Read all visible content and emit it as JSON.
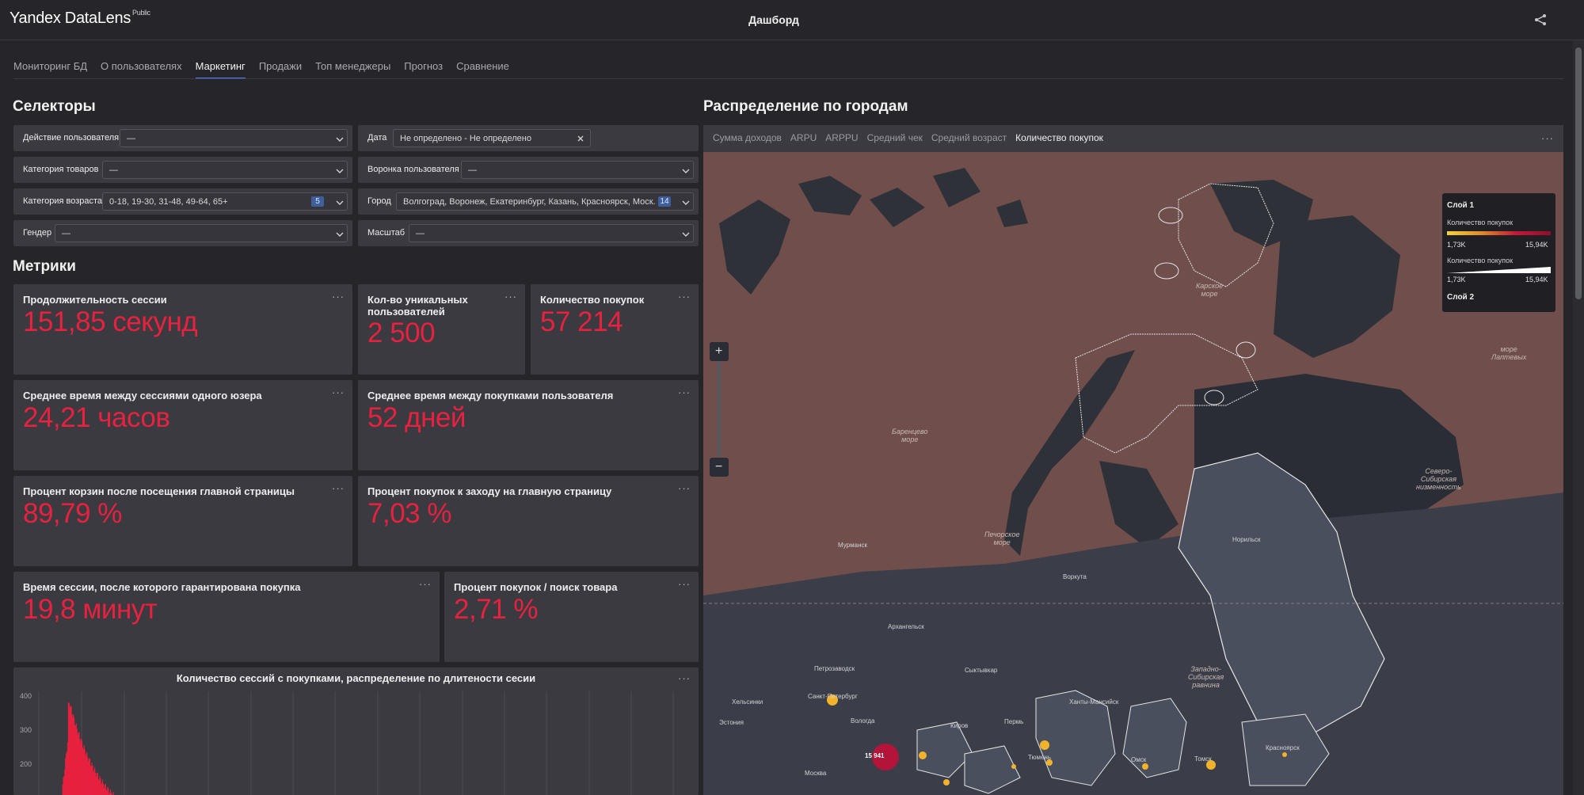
{
  "header": {
    "logo": "Yandex DataLens",
    "logo_badge": "Public",
    "title": "Дашборд"
  },
  "tabs": [
    {
      "label": "Мониторинг БД"
    },
    {
      "label": "О пользователях"
    },
    {
      "label": "Маркетинг",
      "active": true
    },
    {
      "label": "Продажи"
    },
    {
      "label": "Топ менеджеры"
    },
    {
      "label": "Прогноз"
    },
    {
      "label": "Сравнение"
    }
  ],
  "selectors_title": "Селекторы",
  "selectors": {
    "user_action": {
      "label": "Действие пользователя",
      "value": "—"
    },
    "date": {
      "label": "Дата",
      "value": "Не определено - Не определено"
    },
    "product_category": {
      "label": "Категория товаров",
      "value": "—"
    },
    "funnel": {
      "label": "Воронка пользователя",
      "value": "—"
    },
    "age_category": {
      "label": "Категория возраста",
      "value": "0-18, 19-30, 31-48, 49-64, 65+",
      "count": "5"
    },
    "city": {
      "label": "Город",
      "value": "Волгоград, Воронеж, Екатеринбург, Казань, Красноярск, Моск...",
      "count": "14"
    },
    "gender": {
      "label": "Гендер",
      "value": "—"
    },
    "scale": {
      "label": "Масштаб",
      "value": "—"
    }
  },
  "metrics_title": "Метрики",
  "metrics": [
    {
      "title": "Продолжительность сессии",
      "value": "151,85 секунд"
    },
    {
      "title": "Кол-во уникальных пользователей",
      "value": "2 500"
    },
    {
      "title": "Количество покупок",
      "value": "57 214"
    },
    {
      "title": "Среднее время между сессиями одного юзера",
      "value": "24,21 часов"
    },
    {
      "title": "Среднее время между покупками пользователя",
      "value": "52 дней"
    },
    {
      "title": "Процент корзин после посещения главной страницы",
      "value": "89,79 %"
    },
    {
      "title": "Процент покупок к заходу на главную страницу",
      "value": "7,03 %"
    },
    {
      "title": "Время сессии, после которого гарантирована покупка",
      "value": "19,8 минут"
    },
    {
      "title": "Процент покупок / поиск товара",
      "value": "2,71 %"
    }
  ],
  "menu_dots": "···",
  "chart_data": {
    "type": "bar",
    "title": "Количество сессий с покупками, распределение по длитености сесии",
    "y_ticks": [
      "400",
      "300",
      "200"
    ],
    "ylim": [
      0,
      400
    ],
    "color": "#e8213f",
    "visible_peak": 380
  },
  "map": {
    "title": "Распределение по городам",
    "tabs": [
      "Сумма доходов",
      "ARPU",
      "ARPPU",
      "Средний чек",
      "Средний возраст",
      "Количество покупок"
    ],
    "active_tab": "Количество покупок",
    "zoom_in": "+",
    "zoom_out": "−",
    "legend": {
      "layer1": "Слой 1",
      "metric1": "Количество покупок",
      "min1": "1,73K",
      "max1": "15,94K",
      "metric2": "Количество покупок",
      "min2": "1,73K",
      "max2": "15,94K",
      "layer2": "Слой 2"
    },
    "sea_labels": [
      "Карское\nморе",
      "море\nЛаптевых",
      "Баренцево\nморе",
      "Печорское\nморе",
      "Северо-\nСибирская\nнизменность",
      "Западно-\nСибирская\nравнина"
    ],
    "city_labels": [
      "Мурманск",
      "Воркута",
      "Норильск",
      "Архангельск",
      "Петрозаводск",
      "Сыктывкар",
      "Санкт-Петербург",
      "Хельсинки",
      "Вологда",
      "Киров",
      "Пермь",
      "Тюмень",
      "Омск",
      "Томск",
      "Ханты-Мансийск",
      "Красноярск",
      "Эстония",
      "Москва"
    ],
    "cluster_value": "15 941",
    "colors": {
      "accent": "#e8213f",
      "point": "#f2b32b",
      "land": "#6f4e4c",
      "water": "#2c2f36"
    }
  }
}
